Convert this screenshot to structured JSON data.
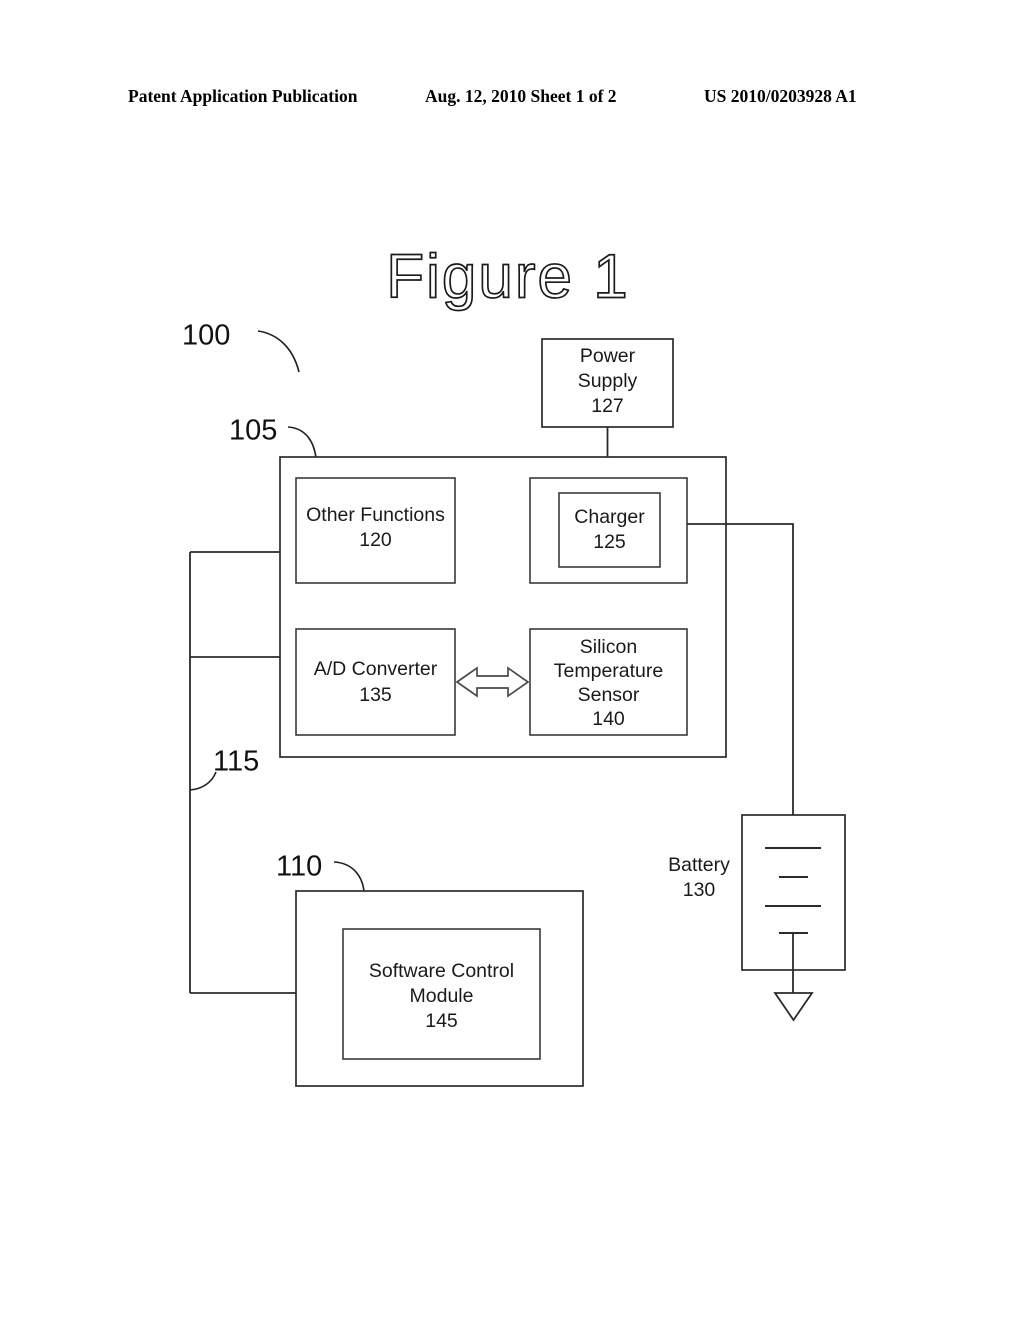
{
  "header": {
    "left": "Patent Application Publication",
    "middle": "Aug. 12, 2010  Sheet 1 of 2",
    "right": "US 2010/0203928 A1"
  },
  "figure": {
    "title": "Figure 1",
    "system_ref": "100"
  },
  "blocks": {
    "power_supply": {
      "line1": "Power",
      "line2": "Supply",
      "ref": "127"
    },
    "device_container": {
      "ref": "105"
    },
    "other_functions": {
      "line1": "Other Functions",
      "ref": "120"
    },
    "charger": {
      "line1": "Charger",
      "ref": "125"
    },
    "ad_converter": {
      "line1": "A/D Converter",
      "ref": "135"
    },
    "temperature_sensor": {
      "line1": "Silicon",
      "line2": "Temperature",
      "line3": "Sensor",
      "ref": "140"
    },
    "battery": {
      "line1": "Battery",
      "ref": "130"
    },
    "host_container": {
      "ref": "110"
    },
    "software_control_module": {
      "line1": "Software Control",
      "line2": "Module",
      "ref": "145"
    },
    "bus": {
      "ref": "115"
    }
  },
  "colors": {
    "ink": "#2b2b2b",
    "text": "#1a1a1a",
    "paper": "#ffffff"
  }
}
